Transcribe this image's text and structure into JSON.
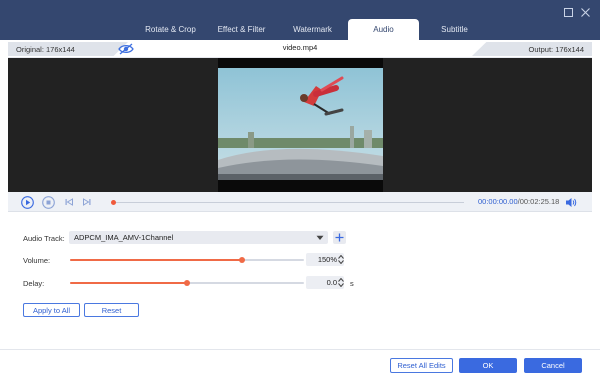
{
  "window": {
    "colors": {
      "titlebar": "#34476f",
      "accent": "#3a6ae0",
      "slider": "#f06a46"
    },
    "controls": {
      "maximize_icon": "maximize-icon",
      "close_icon": "close-icon"
    }
  },
  "tabs": [
    {
      "label": "Rotate & Crop",
      "active": false
    },
    {
      "label": "Effect & Filter",
      "active": false
    },
    {
      "label": "Watermark",
      "active": false
    },
    {
      "label": "Audio",
      "active": true
    },
    {
      "label": "Subtitle",
      "active": false
    }
  ],
  "info": {
    "original": "Original: 176x144",
    "filename": "video.mp4",
    "output": "Output: 176x144"
  },
  "player": {
    "current_time": "00:00:00.00",
    "separator": "/",
    "total_time": "00:02:25.18",
    "progress": 0.0
  },
  "audio": {
    "track_label": "Audio Track:",
    "track_value": "ADPCM_IMA_AMV-1Channel",
    "volume_label": "Volume:",
    "volume_value": "150%",
    "volume_fraction": 0.735,
    "delay_label": "Delay:",
    "delay_value": "0.0",
    "delay_unit": "s",
    "delay_fraction": 0.5
  },
  "actions": {
    "apply_all": "Apply to All",
    "reset": "Reset",
    "reset_all": "Reset All Edits",
    "ok": "OK",
    "cancel": "Cancel"
  }
}
